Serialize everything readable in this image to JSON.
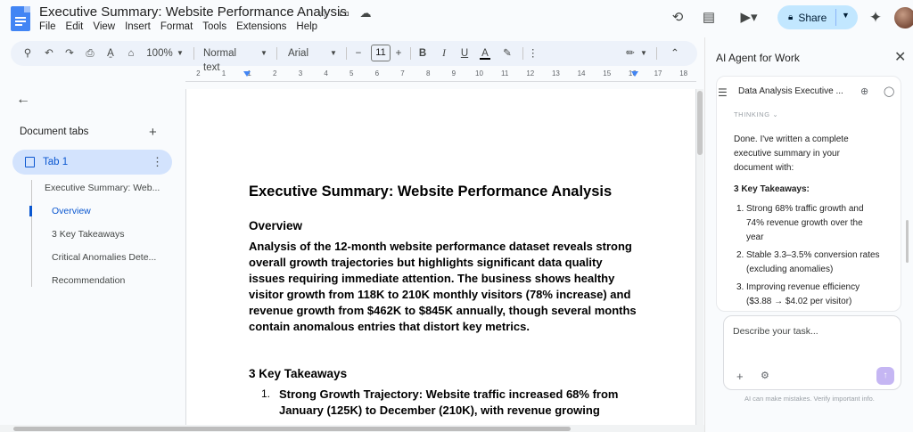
{
  "document": {
    "title": "Executive Summary: Website Performance Analysis"
  },
  "menu": [
    "File",
    "Edit",
    "View",
    "Insert",
    "Format",
    "Tools",
    "Extensions",
    "Help"
  ],
  "share": {
    "label": "Share"
  },
  "toolbar": {
    "zoom": "100%",
    "style": "Normal text",
    "font": "Arial",
    "font_size": "11",
    "bold": "B",
    "italic": "I",
    "underline": "U",
    "text_color": "A"
  },
  "ruler": {
    "ticks": [
      "2",
      "1",
      "1",
      "2",
      "3",
      "4",
      "5",
      "6",
      "7",
      "8",
      "9",
      "10",
      "11",
      "12",
      "13",
      "14",
      "15",
      "16",
      "17",
      "18"
    ]
  },
  "sidebar": {
    "header": "Document tabs",
    "tab_label": "Tab 1",
    "outline": [
      "Executive Summary: Web...",
      "Overview",
      "3 Key Takeaways",
      "Critical Anomalies Dete...",
      "Recommendation"
    ]
  },
  "doc": {
    "heading": "Executive Summary: Website Performance Analysis",
    "overview_heading": "Overview",
    "overview_text": "Analysis of the 12-month website performance dataset reveals strong overall growth trajectories but highlights significant data quality issues requiring immediate attention. The business shows healthy visitor growth from 118K to 210K monthly visitors (78% increase) and revenue growth from $462K to $845K annually, though several months contain anomalous entries that distort key metrics.",
    "takeaways_heading": "3 Key Takeaways",
    "item1_num": "1.",
    "item1_text": "Strong Growth Trajectory: Website traffic increased 68% from January (125K) to December (210K), with revenue growing"
  },
  "ai_panel": {
    "title": "AI Agent for Work",
    "conversation_title": "Data Analysis Executive ...",
    "thinking": "THINKING",
    "message_intro": "Done. I've written a complete executive summary in your document with:",
    "takeaways_label": "3 Key Takeaways:",
    "items": [
      {
        "num": "1.",
        "text": "Strong 68% traffic growth and 74% revenue growth over the year"
      },
      {
        "num": "2.",
        "text": "Stable 3.3–3.5% conversion rates (excluding anomalies)"
      },
      {
        "num": "3.",
        "text": "Improving revenue efficiency ($3.88 → $4.02 per visitor)"
      }
    ],
    "input_placeholder": "Describe your task...",
    "disclaimer": "AI can make mistakes. Verify important info."
  }
}
